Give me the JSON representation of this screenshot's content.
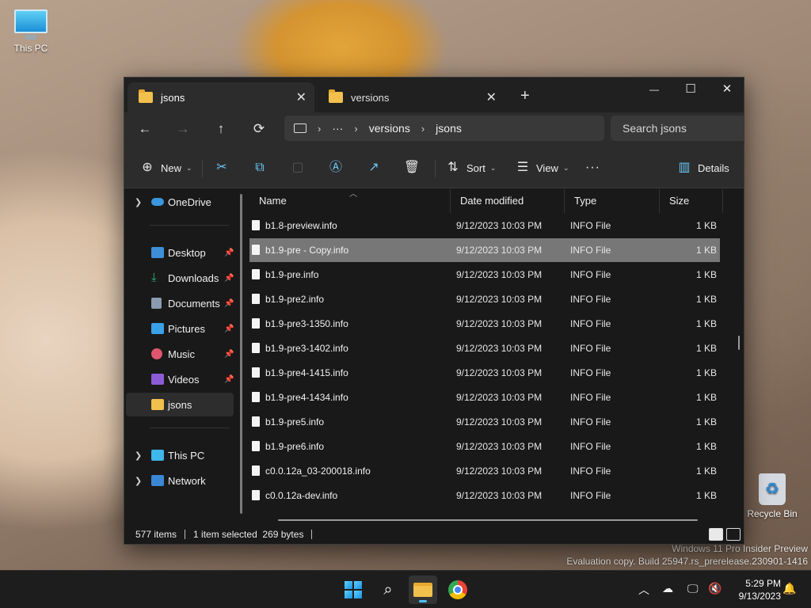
{
  "desktop": {
    "icons": [
      {
        "label": "This PC"
      },
      {
        "label": "Recycle Bin"
      }
    ],
    "watermark": {
      "line1": "Windows 11 Pro Insider Preview",
      "line2": "Evaluation copy. Build 25947.rs_prerelease.230901-1416"
    }
  },
  "explorer": {
    "tabs": [
      {
        "label": "jsons",
        "active": true
      },
      {
        "label": "versions",
        "active": false
      }
    ],
    "window_controls": {
      "minimize": "—",
      "maximize": "☐",
      "close": "✕"
    },
    "new_tab": "+",
    "nav": {
      "back": "←",
      "forward": "→",
      "up": "↑",
      "refresh": "⟳"
    },
    "breadcrumb": {
      "overflow": "···",
      "items": [
        "versions",
        "jsons"
      ]
    },
    "search": {
      "placeholder": "Search jsons"
    },
    "toolbar": {
      "new": "New",
      "sort": "Sort",
      "view": "View",
      "more": "···",
      "details": "Details"
    },
    "sidebar": {
      "items": [
        {
          "label": "OneDrive",
          "icon": "cloud-icon",
          "color": "#3a96dd",
          "expandable": true
        },
        {
          "label": "Desktop",
          "icon": "desktop-icon",
          "color": "#3f8fd8",
          "pinned": true
        },
        {
          "label": "Downloads",
          "icon": "download-icon",
          "color": "#34b27b",
          "pinned": true
        },
        {
          "label": "Documents",
          "icon": "documents-icon",
          "color": "#8a9bb0",
          "pinned": true
        },
        {
          "label": "Pictures",
          "icon": "pictures-icon",
          "color": "#3aa0e8",
          "pinned": true
        },
        {
          "label": "Music",
          "icon": "music-icon",
          "color": "#e0566f",
          "pinned": true
        },
        {
          "label": "Videos",
          "icon": "videos-icon",
          "color": "#8b5cd6",
          "pinned": true
        },
        {
          "label": "jsons",
          "icon": "folder-icon",
          "color": "#f2c04c",
          "selected": true
        },
        {
          "label": "This PC",
          "icon": "this-pc-icon",
          "color": "#3fb6ec",
          "expandable": true
        },
        {
          "label": "Network",
          "icon": "network-icon",
          "color": "#3a88d4",
          "expandable": true
        }
      ]
    },
    "columns": {
      "name": "Name",
      "date": "Date modified",
      "type": "Type",
      "size": "Size"
    },
    "files": [
      {
        "name": "b1.8-preview.info",
        "date": "9/12/2023 10:03 PM",
        "type": "INFO File",
        "size": "1 KB"
      },
      {
        "name": "b1.9-pre - Copy.info",
        "date": "9/12/2023 10:03 PM",
        "type": "INFO File",
        "size": "1 KB",
        "selected": true
      },
      {
        "name": "b1.9-pre.info",
        "date": "9/12/2023 10:03 PM",
        "type": "INFO File",
        "size": "1 KB"
      },
      {
        "name": "b1.9-pre2.info",
        "date": "9/12/2023 10:03 PM",
        "type": "INFO File",
        "size": "1 KB"
      },
      {
        "name": "b1.9-pre3-1350.info",
        "date": "9/12/2023 10:03 PM",
        "type": "INFO File",
        "size": "1 KB"
      },
      {
        "name": "b1.9-pre3-1402.info",
        "date": "9/12/2023 10:03 PM",
        "type": "INFO File",
        "size": "1 KB"
      },
      {
        "name": "b1.9-pre4-1415.info",
        "date": "9/12/2023 10:03 PM",
        "type": "INFO File",
        "size": "1 KB"
      },
      {
        "name": "b1.9-pre4-1434.info",
        "date": "9/12/2023 10:03 PM",
        "type": "INFO File",
        "size": "1 KB"
      },
      {
        "name": "b1.9-pre5.info",
        "date": "9/12/2023 10:03 PM",
        "type": "INFO File",
        "size": "1 KB"
      },
      {
        "name": "b1.9-pre6.info",
        "date": "9/12/2023 10:03 PM",
        "type": "INFO File",
        "size": "1 KB"
      },
      {
        "name": "c0.0.12a_03-200018.info",
        "date": "9/12/2023 10:03 PM",
        "type": "INFO File",
        "size": "1 KB"
      },
      {
        "name": "c0.0.12a-dev.info",
        "date": "9/12/2023 10:03 PM",
        "type": "INFO File",
        "size": "1 KB"
      }
    ],
    "status": {
      "count": "577 items",
      "selection": "1 item selected  269 bytes"
    }
  },
  "taskbar": {
    "clock": {
      "time": "5:29 PM",
      "date": "9/13/2023"
    },
    "accent": "#4cc2ff"
  }
}
